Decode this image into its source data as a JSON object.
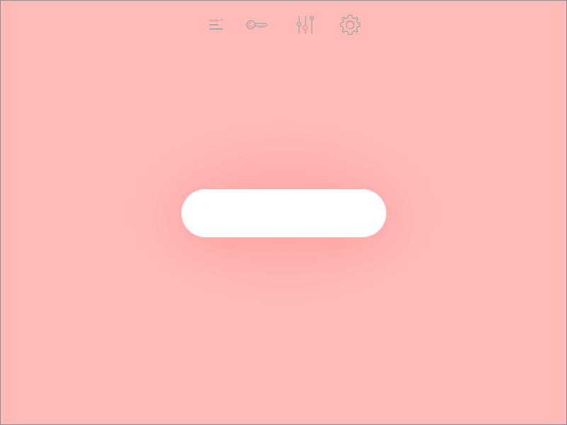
{
  "toolbar": {
    "buttons": [
      {
        "id": "menu",
        "icon": "menu-lines-icon"
      },
      {
        "id": "key",
        "icon": "key-icon"
      },
      {
        "id": "sliders",
        "icon": "sliders-icon"
      },
      {
        "id": "settings",
        "icon": "gear-icon"
      }
    ]
  },
  "colors": {
    "background": "#ffbbb8",
    "background_center": "#ffaeae",
    "toolbar": "#ffffff",
    "icon_gray": "#a9a9a9",
    "icon_accent": "#f09a9a"
  }
}
